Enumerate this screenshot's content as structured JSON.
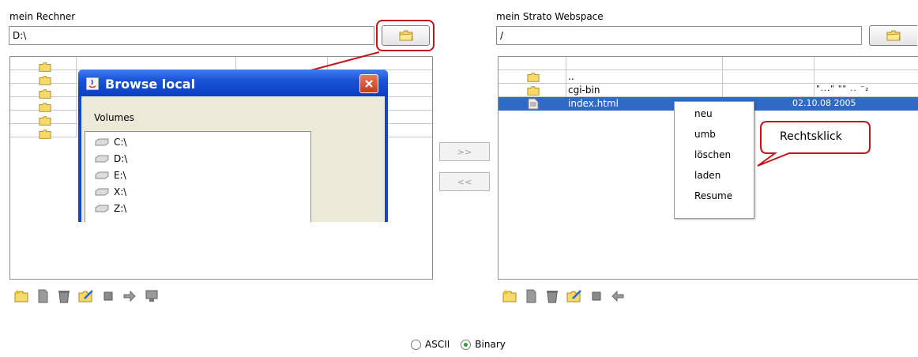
{
  "local": {
    "title": "mein Rechner",
    "path": "D:\\",
    "rows": [
      "",
      "",
      "",
      "",
      "",
      ""
    ]
  },
  "remote": {
    "title": "mein Strato Webspace",
    "path": "/",
    "rows": [
      {
        "name": "..",
        "date": ""
      },
      {
        "name": "cgi-bin",
        "date": "\"...\" \"\" ..  ⁻₂"
      },
      {
        "name": "index.html",
        "date": "02.10.08 2005"
      }
    ]
  },
  "dialog": {
    "title": "Browse local",
    "volumes_label": "Volumes",
    "volumes": [
      "C:\\",
      "D:\\",
      "E:\\",
      "X:\\",
      "Z:\\"
    ]
  },
  "transfer": {
    "to_remote": ">>",
    "to_local": "<<"
  },
  "context_menu": {
    "items": [
      "neu",
      "umb",
      "löschen",
      "laden",
      "Resume"
    ]
  },
  "callout": {
    "text": "Rechtsklick"
  },
  "mode": {
    "ascii": "ASCII",
    "binary": "Binary",
    "selected": "Binary"
  },
  "colors": {
    "selection": "#316ac5",
    "dialog_frame": "#1446c2",
    "highlight_red": "#c0161b"
  }
}
